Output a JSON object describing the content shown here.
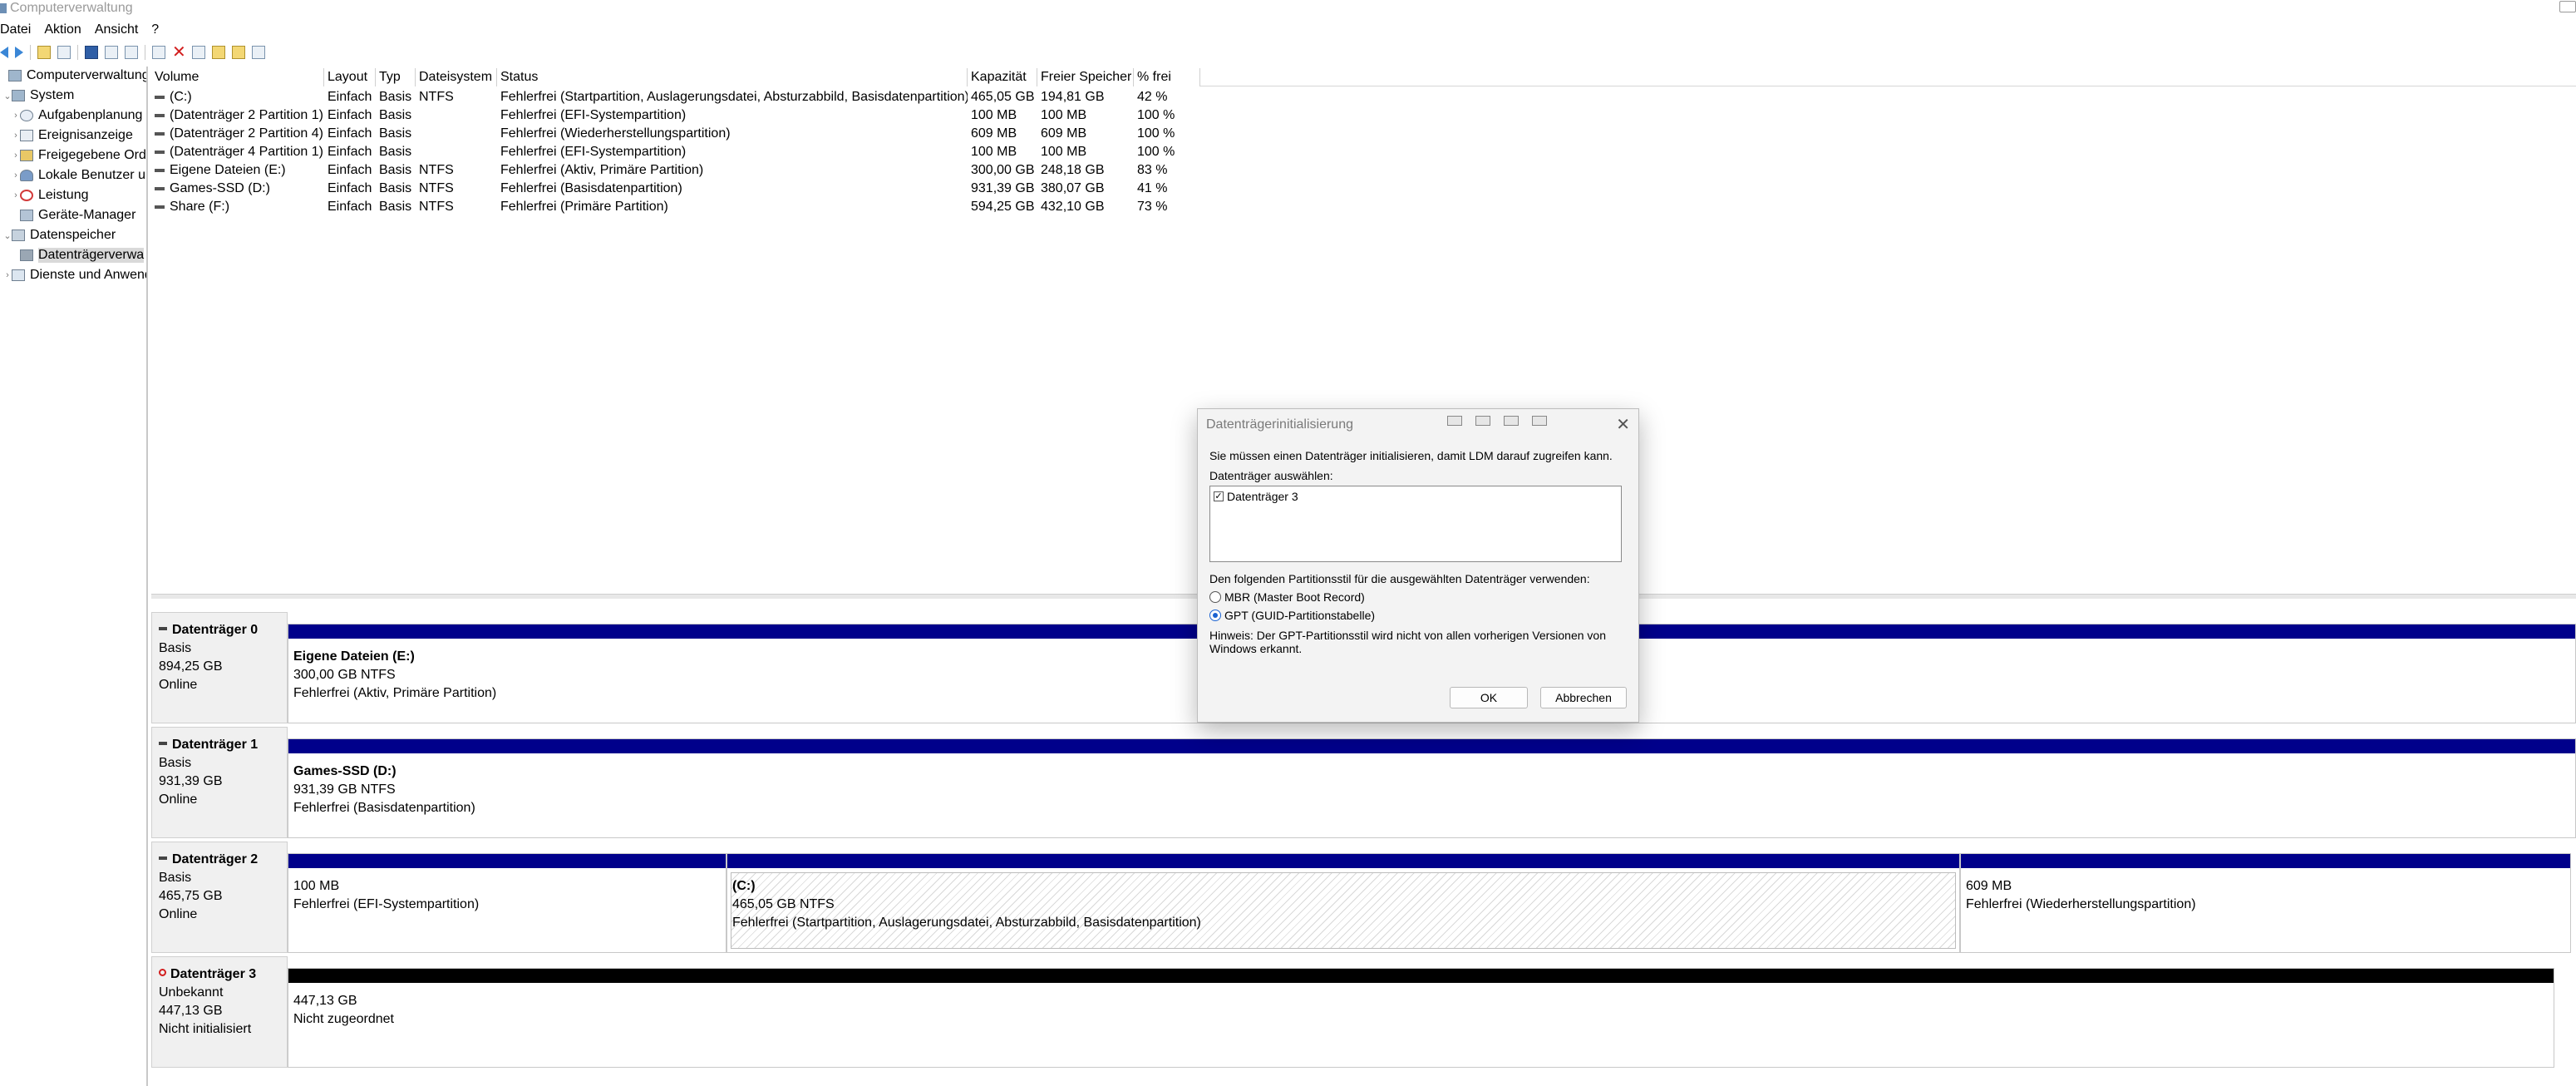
{
  "window": {
    "title": "Computerverwaltung"
  },
  "menu": [
    "Datei",
    "Aktion",
    "Ansicht",
    "?"
  ],
  "tree": [
    {
      "label": "Computerverwaltung (L",
      "icon": "computer-icon",
      "indent": 0,
      "expander": ""
    },
    {
      "label": "System",
      "icon": "system-icon",
      "indent": 1,
      "expander": "⌄"
    },
    {
      "label": "Aufgabenplanung",
      "icon": "clock-icon",
      "indent": 2,
      "expander": "›"
    },
    {
      "label": "Ereignisanzeige",
      "icon": "event-viewer-icon",
      "indent": 2,
      "expander": "›"
    },
    {
      "label": "Freigegebene Ord",
      "icon": "shared-folder-icon",
      "indent": 2,
      "expander": "›"
    },
    {
      "label": "Lokale Benutzer u",
      "icon": "users-icon",
      "indent": 2,
      "expander": "›"
    },
    {
      "label": "Leistung",
      "icon": "performance-icon",
      "indent": 2,
      "expander": "›"
    },
    {
      "label": "Geräte-Manager",
      "icon": "device-manager-icon",
      "indent": 2,
      "expander": ""
    },
    {
      "label": "Datenspeicher",
      "icon": "storage-icon",
      "indent": 1,
      "expander": "⌄"
    },
    {
      "label": "Datenträgerverwa",
      "icon": "disk-management-icon",
      "indent": 2,
      "expander": "",
      "selected": true
    },
    {
      "label": "Dienste und Anwend",
      "icon": "services-icon",
      "indent": 1,
      "expander": "›"
    }
  ],
  "volumes": {
    "headers": [
      "Volume",
      "Layout",
      "Typ",
      "Dateisystem",
      "Status",
      "Kapazität",
      "Freier Speicher",
      "% frei"
    ],
    "rows": [
      [
        "(C:)",
        "Einfach",
        "Basis",
        "NTFS",
        "Fehlerfrei (Startpartition, Auslagerungsdatei, Absturzabbild, Basisdatenpartition)",
        "465,05 GB",
        "194,81 GB",
        "42 %"
      ],
      [
        "(Datenträger 2 Partition 1)",
        "Einfach",
        "Basis",
        "",
        "Fehlerfrei (EFI-Systempartition)",
        "100 MB",
        "100 MB",
        "100 %"
      ],
      [
        "(Datenträger 2 Partition 4)",
        "Einfach",
        "Basis",
        "",
        "Fehlerfrei (Wiederherstellungspartition)",
        "609 MB",
        "609 MB",
        "100 %"
      ],
      [
        "(Datenträger 4 Partition 1)",
        "Einfach",
        "Basis",
        "",
        "Fehlerfrei (EFI-Systempartition)",
        "100 MB",
        "100 MB",
        "100 %"
      ],
      [
        "Eigene Dateien (E:)",
        "Einfach",
        "Basis",
        "NTFS",
        "Fehlerfrei (Aktiv, Primäre Partition)",
        "300,00 GB",
        "248,18 GB",
        "83 %"
      ],
      [
        "Games-SSD (D:)",
        "Einfach",
        "Basis",
        "NTFS",
        "Fehlerfrei (Basisdatenpartition)",
        "931,39 GB",
        "380,07 GB",
        "41 %"
      ],
      [
        "Share (F:)",
        "Einfach",
        "Basis",
        "NTFS",
        "Fehlerfrei (Primäre Partition)",
        "594,25 GB",
        "432,10 GB",
        "73 %"
      ]
    ]
  },
  "disks": [
    {
      "name": "Datenträger 0",
      "type": "Basis",
      "size": "894,25 GB",
      "state": "Online",
      "partitions": [
        {
          "name": "Eigene Dateien  (E:)",
          "size": "300,00 GB NTFS",
          "status": "Fehlerfrei (Aktiv, Primäre Partition)"
        }
      ]
    },
    {
      "name": "Datenträger 1",
      "type": "Basis",
      "size": "931,39 GB",
      "state": "Online",
      "partitions": [
        {
          "name": "Games-SSD  (D:)",
          "size": "931,39 GB NTFS",
          "status": "Fehlerfrei (Basisdatenpartition)"
        }
      ]
    },
    {
      "name": "Datenträger 2",
      "type": "Basis",
      "size": "465,75 GB",
      "state": "Online",
      "partitions": [
        {
          "name": "",
          "size": "100 MB",
          "status": "Fehlerfrei (EFI-Systempartition)"
        },
        {
          "name": "(C:)",
          "size": "465,05 GB NTFS",
          "status": "Fehlerfrei (Startpartition, Auslagerungsdatei, Absturzabbild, Basisdatenpartition)"
        },
        {
          "name": "",
          "size": "609 MB",
          "status": "Fehlerfrei (Wiederherstellungspartition)"
        }
      ]
    },
    {
      "name": "Datenträger 3",
      "type": "Unbekannt",
      "size": "447,13 GB",
      "state": "Nicht initialisiert",
      "partitions": [
        {
          "name": "",
          "size": "447,13 GB",
          "status": "Nicht zugeordnet"
        }
      ]
    }
  ],
  "dialog": {
    "title": "Datenträgerinitialisierung",
    "message": "Sie müssen einen Datenträger initialisieren, damit LDM darauf zugreifen kann.",
    "select_label": "Datenträger auswählen:",
    "disk_item": "Datenträger 3",
    "style_label": "Den folgenden Partitionsstil für die ausgewählten Datenträger verwenden:",
    "option_mbr": "MBR (Master Boot Record)",
    "option_gpt": "GPT (GUID-Partitionstabelle)",
    "hint": "Hinweis: Der GPT-Partitionsstil wird nicht von allen vorherigen Versionen von Windows erkannt.",
    "ok_label": "OK",
    "cancel_label": "Abbrechen"
  },
  "colors": {
    "primary_partition": "#00008b",
    "unallocated": "#000000",
    "selected_tree": "#d9d9d9"
  }
}
